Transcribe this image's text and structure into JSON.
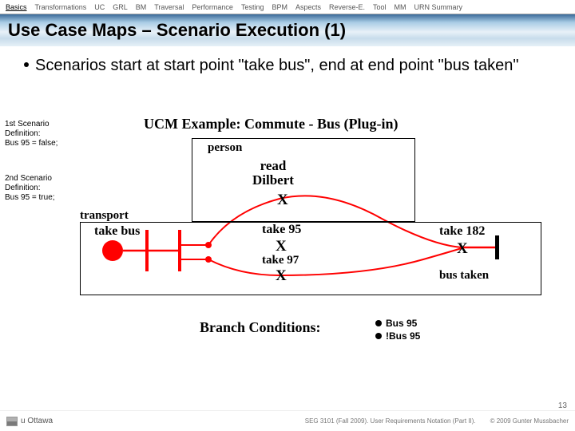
{
  "tabs": [
    "Basics",
    "Transformations",
    "UC",
    "GRL",
    "BM",
    "Traversal",
    "Performance",
    "Testing",
    "BPM",
    "Aspects",
    "Reverse-E.",
    "Tool",
    "MM",
    "URN Summary"
  ],
  "active_tab": 0,
  "title": "Use Case Maps – Scenario Execution (1)",
  "bullet": "Scenarios start at start point \"take bus\", end at end point \"bus taken\"",
  "scen1": {
    "l1": "1st Scenario",
    "l2": "Definition:",
    "l3": "Bus 95 = false;"
  },
  "scen2": {
    "l1": "2nd Scenario",
    "l2": "Definition:",
    "l3": "Bus 95 = true;"
  },
  "diagram": {
    "title": "UCM Example: Commute - Bus (Plug-in)",
    "person": "person",
    "read_dilbert_l1": "read",
    "read_dilbert_l2": "Dilbert",
    "x": "X",
    "transport": "transport",
    "take_bus": "take bus",
    "take95": "take 95",
    "take97": "take 97",
    "take182": "take 182",
    "bus_taken": "bus taken"
  },
  "branch": {
    "label": "Branch Conditions:",
    "i1": "Bus 95",
    "i2": "!Bus 95"
  },
  "page_num": "13",
  "footer": {
    "uo": "u Ottawa",
    "left": "SEG 3101 (Fall 2009).   User Requirements Notation (Part II).",
    "right": "© 2009 Gunter Mussbacher"
  }
}
